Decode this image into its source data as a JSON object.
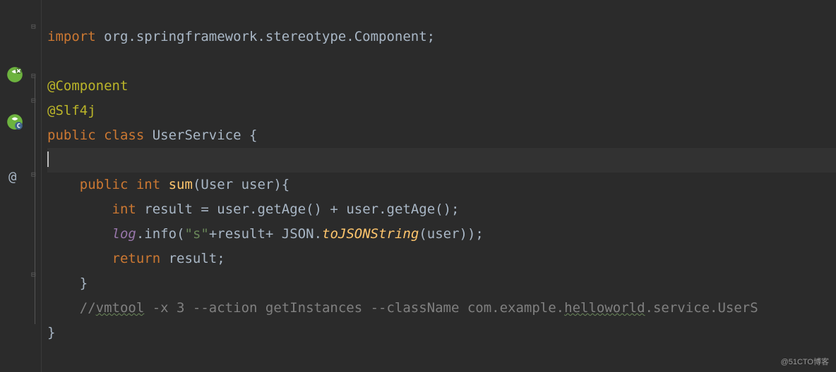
{
  "gutter": {
    "at_symbol": "@"
  },
  "code": {
    "line1": {
      "import": "import ",
      "pkg": "org.springframework.stereotype.",
      "cls": "Component",
      "semi": ";"
    },
    "line2": "",
    "line3": {
      "anno": "@Component"
    },
    "line4": {
      "anno": "@Slf4j"
    },
    "line5": {
      "pub": "public ",
      "cls_kw": "class ",
      "name": "UserService ",
      "brace": "{"
    },
    "line6": "",
    "line7": {
      "indent": "    ",
      "pub": "public ",
      "int": "int ",
      "method": "sum",
      "paren": "(",
      "param_type": "User ",
      "param_name": "user",
      "close": "){"
    },
    "line8": {
      "indent": "        ",
      "int": "int ",
      "var": "result ",
      "eq": "= ",
      "obj": "user",
      "dot1": ".",
      "m1": "getAge",
      "p1": "() + ",
      "obj2": "user",
      "dot2": ".",
      "m2": "getAge",
      "p2": "();"
    },
    "line9": {
      "indent": "        ",
      "log": "log",
      "dot": ".",
      "info": "info",
      "open": "(",
      "str": "\"s\"",
      "plus1": "+result+ ",
      "json": "JSON",
      "dot2": ".",
      "tojson": "toJSONString",
      "open2": "(",
      "user": "user",
      "close": "));"
    },
    "line10": {
      "indent": "        ",
      "ret": "return ",
      "var": "result;"
    },
    "line11": {
      "indent": "    ",
      "brace": "}"
    },
    "line12": {
      "indent": "    ",
      "c1": "//",
      "c2": "vmtool",
      "c3": " -x 3 --action getInstances --className com.example.",
      "c4": "helloworld",
      "c5": ".service.UserS"
    },
    "line13": {
      "brace": "}"
    }
  },
  "watermark": "@51CTO博客"
}
